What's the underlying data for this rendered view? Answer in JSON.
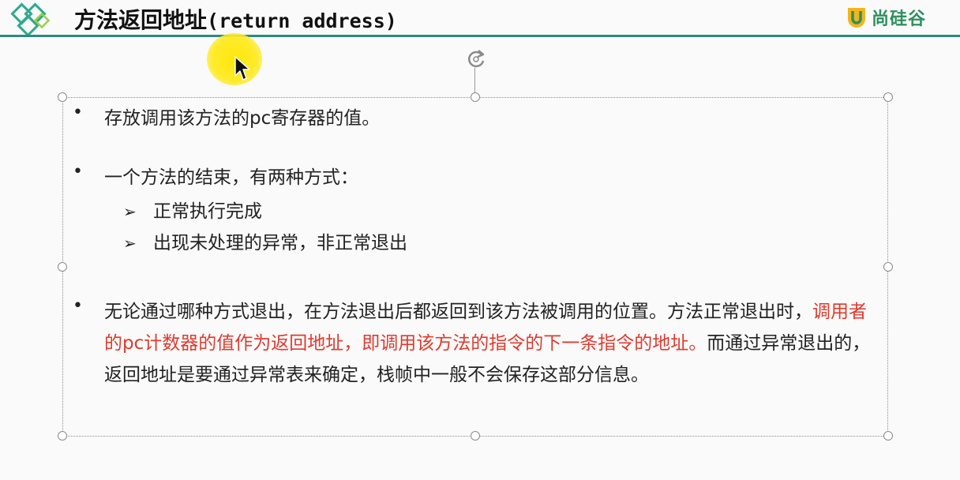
{
  "header": {
    "title_zh": "方法返回地址",
    "title_en": "(return address)",
    "brand_name": "尚硅谷",
    "brand_color": "#2f8f5f",
    "rule_color": "#2e8a7e"
  },
  "content": {
    "bullet1": "存放调用该方法的pc寄存器的值。",
    "bullet2": "一个方法的结束，有两种方式：",
    "sub1": "正常执行完成",
    "sub2": "出现未处理的异常，非正常退出",
    "bullet3": {
      "part1": "无论通过哪种方式退出，在方法退出后都返回到该方法被调用的位置。方法正常退出时，",
      "part2_highlight": "调用者的pc计数器的值作为返回地址，即调用该方法的指令的下一条指令的地址。",
      "part3": "而通过异常退出的，返回地址是要通过异常表来确定，栈帧中一般不会保存这部分信息。"
    },
    "highlight_color": "#e03a2e"
  },
  "icons": {
    "logo": "diamond-lattice-icon",
    "brand": "u-shield-icon",
    "rotate": "rotate-handle-icon",
    "cursor": "mouse-pointer-icon",
    "bullet": "•",
    "sub_bullet": "➢"
  }
}
